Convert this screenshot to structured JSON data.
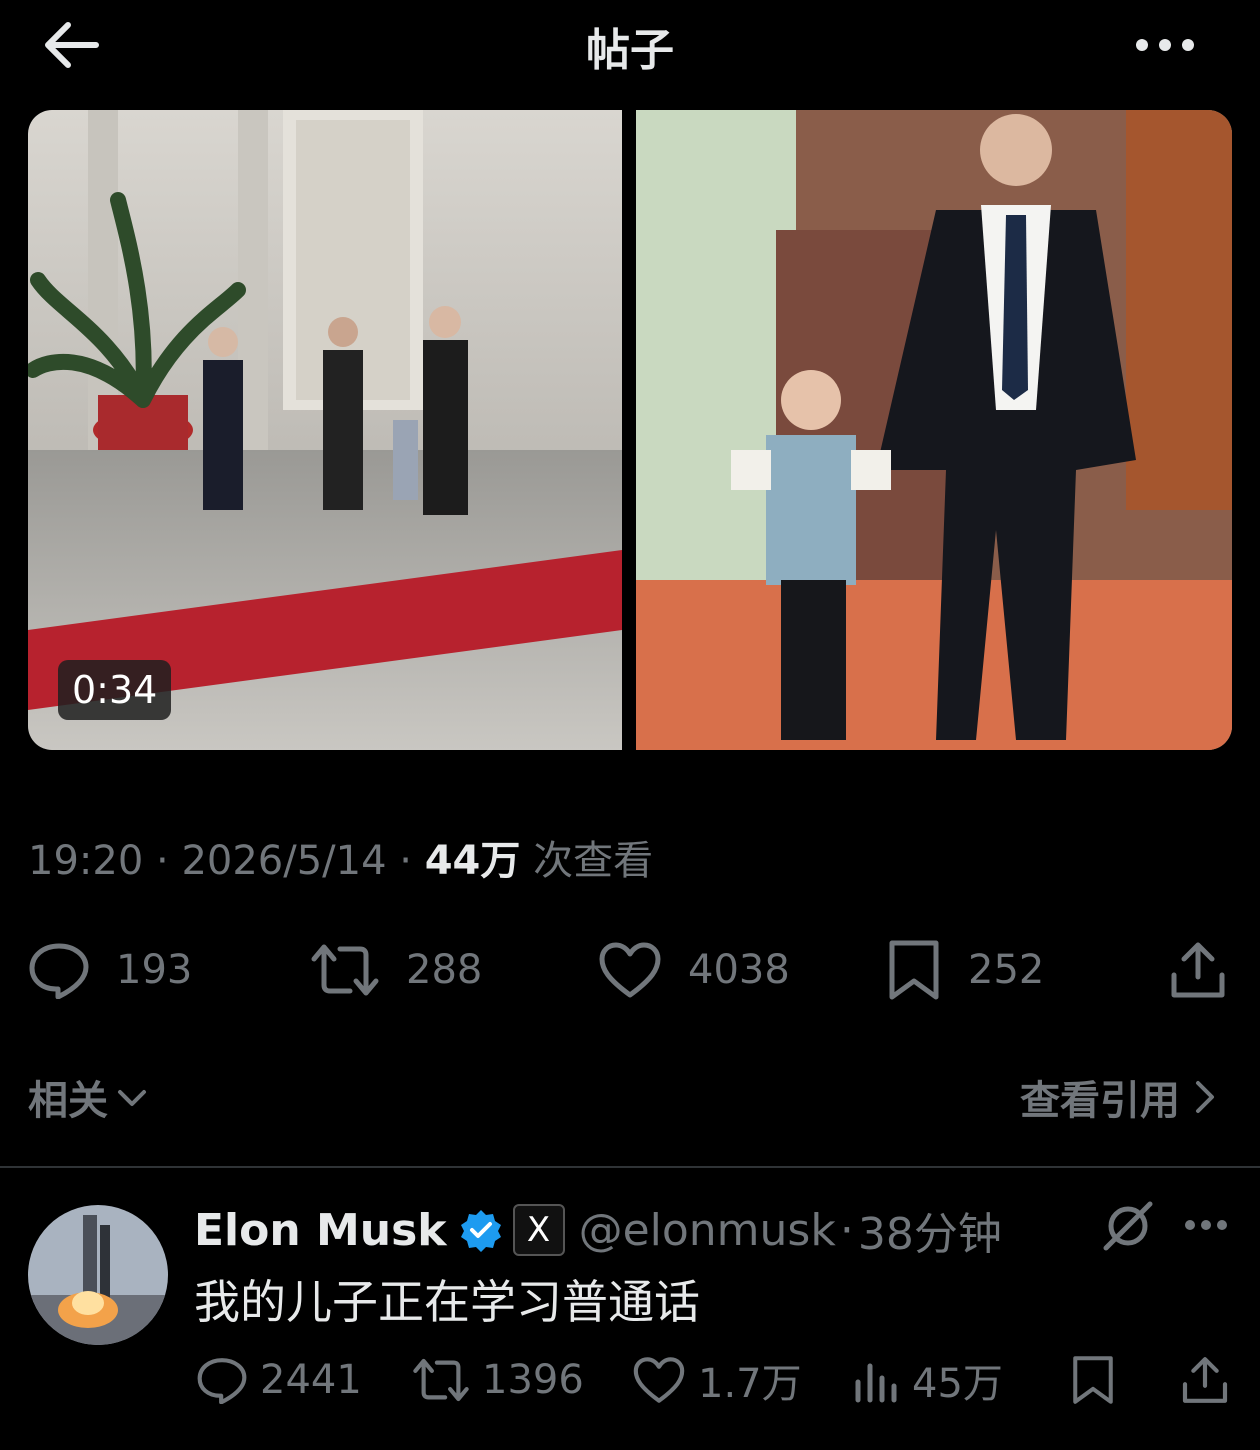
{
  "header": {
    "title": "帖子",
    "back_icon": "arrow-left-icon",
    "more_icon": "more-horizontal-icon"
  },
  "media": {
    "video_duration": "0:34"
  },
  "meta": {
    "time": "19:20",
    "date": "2026/5/14",
    "views_count": "44万",
    "views_label": "次查看"
  },
  "actions": {
    "replies": "193",
    "reposts": "288",
    "likes": "4038",
    "bookmarks": "252"
  },
  "related": {
    "label": "相关",
    "view_quotes": "查看引用"
  },
  "reply": {
    "name": "Elon Musk",
    "handle": "@elonmusk",
    "time": "38分钟",
    "badge_letter": "X",
    "text": "我的儿子正在学习普通话",
    "replies": "2441",
    "reposts": "1396",
    "likes": "1.7万",
    "views": "45万"
  },
  "colors": {
    "background": "#000000",
    "text_primary": "#e7e9ea",
    "text_secondary": "#71767b",
    "verified_blue": "#1d9bf0"
  }
}
